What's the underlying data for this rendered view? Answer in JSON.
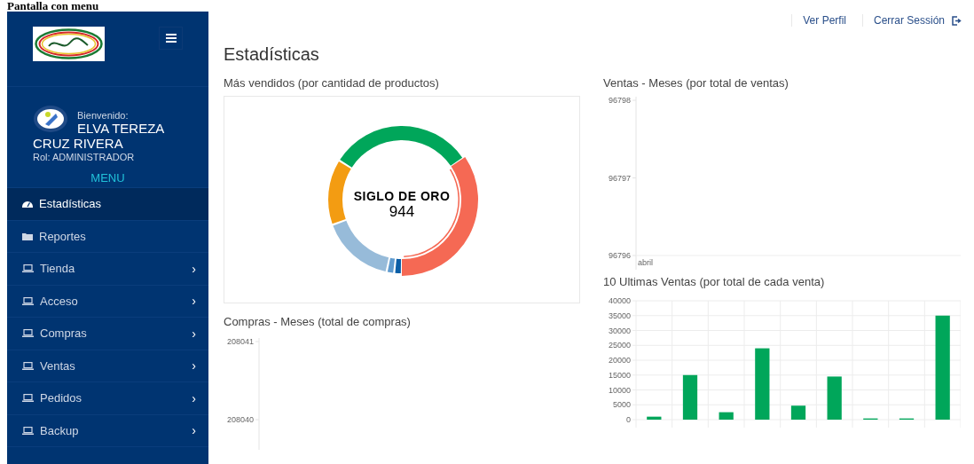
{
  "page_heading": "Pantalla con menu",
  "sidebar": {
    "user": {
      "greeting": "Bienvenido:",
      "name": "ELVA TEREZA CRUZ RIVERA",
      "role": "Rol: ADMINISTRADOR"
    },
    "menu_label": "MENU",
    "items": [
      {
        "label": "Estadísticas",
        "kind": "gauge",
        "selected": true
      },
      {
        "label": "Reportes",
        "kind": "folder",
        "selected": false
      },
      {
        "label": "Tienda",
        "kind": "laptop",
        "selected": false,
        "chevron": "›"
      },
      {
        "label": "Acceso",
        "kind": "laptop",
        "selected": false,
        "chevron": "›"
      },
      {
        "label": "Compras",
        "kind": "laptop",
        "selected": false,
        "chevron": "›"
      },
      {
        "label": "Ventas",
        "kind": "laptop",
        "selected": false,
        "chevron": "›"
      },
      {
        "label": "Pedidos",
        "kind": "laptop",
        "selected": false,
        "chevron": "›"
      },
      {
        "label": "Backup",
        "kind": "laptop",
        "selected": false,
        "chevron": "›"
      }
    ]
  },
  "top_links": [
    {
      "label": "Ver Perfil",
      "kind": "plain"
    },
    {
      "label": "Cerrar Sessión",
      "kind": "logout"
    }
  ],
  "main": {
    "title": "Estadísticas",
    "best_sellers": {
      "title": "Más vendidos (por cantidad de productos)",
      "center_label": "SIGLO DE ORO",
      "center_value": "944"
    },
    "purchases_by_month": {
      "title": "Compras - Meses (total de compras)",
      "y_axis_labels": [
        "208041",
        "208040"
      ]
    },
    "sales_by_month": {
      "title": "Ventas - Meses (por total de ventas)",
      "y_axis_labels": [
        "96798",
        "96797",
        "96796"
      ],
      "x_axis_labels": [
        "abril"
      ]
    },
    "last_sales": {
      "title": "10 Ultimas Ventas (por total de cada venta)",
      "chart_data": {
        "type": "bar",
        "grid": true,
        "values": [
          1000,
          15000,
          2500,
          24000,
          4700,
          14500,
          400,
          400,
          35000
        ],
        "ylim": [
          0,
          40000
        ],
        "yticks": [
          0,
          5000,
          10000,
          15000,
          20000,
          25000,
          30000,
          35000,
          40000
        ]
      }
    }
  }
}
